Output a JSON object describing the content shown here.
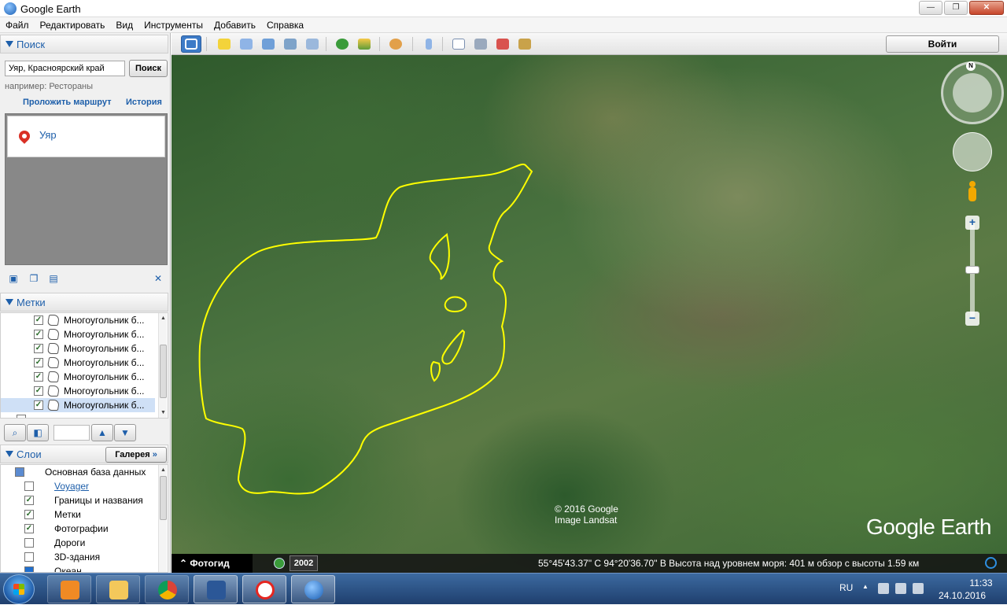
{
  "window": {
    "title": "Google Earth"
  },
  "menu": [
    "Файл",
    "Редактировать",
    "Вид",
    "Инструменты",
    "Добавить",
    "Справка"
  ],
  "search": {
    "header": "Поиск",
    "query": "Уяр, Красноярский край",
    "button": "Поиск",
    "hint": "например: Рестораны",
    "route_link": "Проложить маршрут",
    "history_link": "История",
    "result": "Уяр"
  },
  "places": {
    "header": "Метки",
    "items": [
      "Многоугольник б...",
      "Многоугольник б...",
      "Многоугольник б...",
      "Многоугольник б...",
      "Многоугольник б...",
      "Многоугольник б...",
      "Многоугольник б..."
    ]
  },
  "layers": {
    "header": "Слои",
    "gallery_button": "Галерея",
    "gallery_arrows": "»",
    "items": [
      {
        "label": "Основная база данных",
        "checked": true
      },
      {
        "label": "Voyager",
        "checked": false
      },
      {
        "label": "Границы и названия",
        "checked": true
      },
      {
        "label": "Метки",
        "checked": true
      },
      {
        "label": "Фотографии",
        "checked": true
      },
      {
        "label": "Дороги",
        "checked": false
      },
      {
        "label": "3D-здания",
        "checked": false
      },
      {
        "label": "Океан",
        "checked": false
      }
    ]
  },
  "toolbar": {
    "signin": "Войти"
  },
  "map": {
    "copyright_line1": "© 2016 Google",
    "copyright_line2": "Image Landsat",
    "logo": "Google Earth",
    "compass_n": "N",
    "polygon_color": "#ffff00"
  },
  "status": {
    "tour_tab": "Фотогид",
    "tour_arrow": "⌃",
    "year": "2002",
    "coords": "55°45'43.37\" С   94°20'36.70\" В   Высота над уровнем моря:   401 м      обзор с высоты   1.59 км"
  },
  "taskbar": {
    "lang": "RU",
    "time": "11:33",
    "date": "24.10.2016"
  }
}
